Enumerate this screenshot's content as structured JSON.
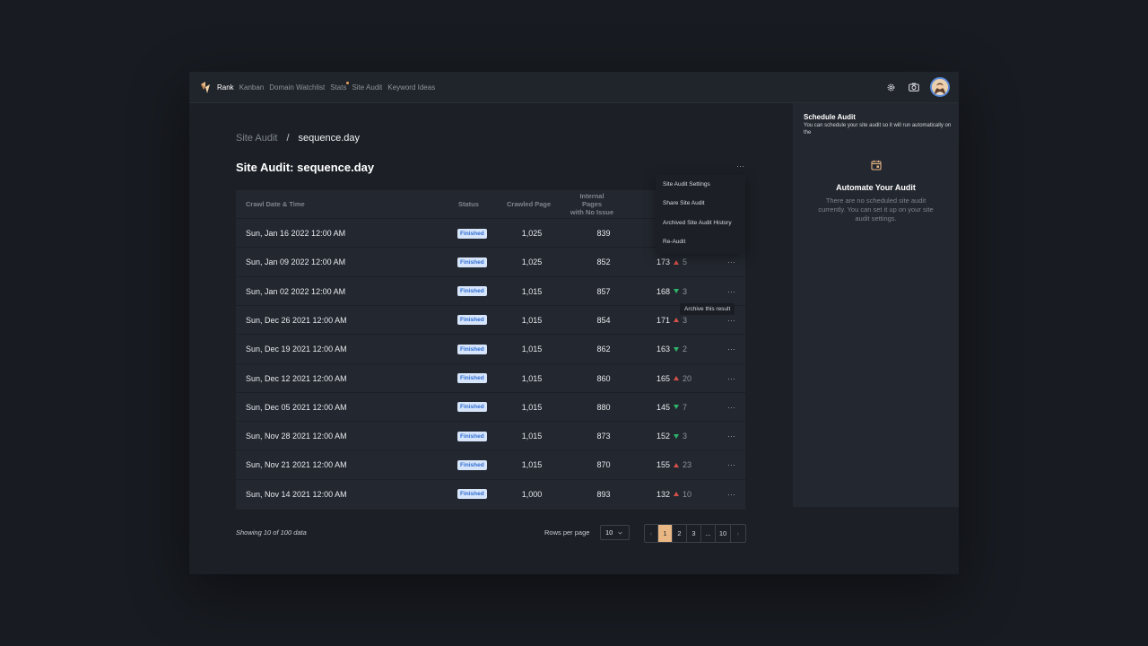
{
  "nav": {
    "items": [
      "Rank",
      "Kanban",
      "Domain Watchlist",
      "Stats",
      "Site Audit",
      "Keyword Ideas"
    ],
    "active": "Rank"
  },
  "breadcrumb": {
    "parent": "Site Audit",
    "separator": "/",
    "current": "sequence.day"
  },
  "page": {
    "title": "Site Audit: sequence.day",
    "more": "···"
  },
  "table": {
    "headers": {
      "date": "Crawl Date & Time",
      "status": "Status",
      "crawled": "Crawled Page",
      "no_issue_1": "Internal Pages",
      "no_issue_2": "with No Issue"
    },
    "rows": [
      {
        "date": "Sun, Jan 16 2022 12:00 AM",
        "status": "Finished",
        "crawled": "1,025",
        "no_issue": "839",
        "issues": "",
        "delta": "",
        "dir": ""
      },
      {
        "date": "Sun, Jan 09 2022 12:00 AM",
        "status": "Finished",
        "crawled": "1,025",
        "no_issue": "852",
        "issues": "173",
        "delta": "5",
        "dir": "up"
      },
      {
        "date": "Sun, Jan 02 2022 12:00 AM",
        "status": "Finished",
        "crawled": "1,015",
        "no_issue": "857",
        "issues": "168",
        "delta": "3",
        "dir": "down"
      },
      {
        "date": "Sun, Dec 26 2021 12:00 AM",
        "status": "Finished",
        "crawled": "1,015",
        "no_issue": "854",
        "issues": "171",
        "delta": "3",
        "dir": "up"
      },
      {
        "date": "Sun, Dec 19 2021 12:00 AM",
        "status": "Finished",
        "crawled": "1,015",
        "no_issue": "862",
        "issues": "163",
        "delta": "2",
        "dir": "down"
      },
      {
        "date": "Sun, Dec 12 2021 12:00 AM",
        "status": "Finished",
        "crawled": "1,015",
        "no_issue": "860",
        "issues": "165",
        "delta": "20",
        "dir": "up"
      },
      {
        "date": "Sun, Dec 05 2021 12:00 AM",
        "status": "Finished",
        "crawled": "1,015",
        "no_issue": "880",
        "issues": "145",
        "delta": "7",
        "dir": "down"
      },
      {
        "date": "Sun, Nov 28 2021 12:00 AM",
        "status": "Finished",
        "crawled": "1,015",
        "no_issue": "873",
        "issues": "152",
        "delta": "3",
        "dir": "down"
      },
      {
        "date": "Sun, Nov 21 2021 12:00 AM",
        "status": "Finished",
        "crawled": "1,015",
        "no_issue": "870",
        "issues": "155",
        "delta": "23",
        "dir": "up"
      },
      {
        "date": "Sun, Nov 14 2021 12:00 AM",
        "status": "Finished",
        "crawled": "1,000",
        "no_issue": "893",
        "issues": "132",
        "delta": "10",
        "dir": "up"
      }
    ],
    "row_more": "···"
  },
  "dropdown_menu": {
    "items": [
      "Site Audit Settings",
      "Share Site Audit",
      "Archived Site Audit History",
      "Re-Audit"
    ]
  },
  "tooltip": {
    "text": "Archive this result"
  },
  "footer": {
    "showing": "Showing 10 of 100 data",
    "rows_label": "Rows per page",
    "rows_value": "10",
    "pages": [
      "1",
      "2",
      "3",
      "...",
      "10"
    ],
    "current_page": "1",
    "prev": "‹",
    "next": "›"
  },
  "sidebar": {
    "title": "Schedule Audit",
    "subtitle": "You can schedule your site audit so it will run automatically on the",
    "heading": "Automate Your Audit",
    "body": "There are no scheduled site audit currently. You can set it up on your site audit settings."
  },
  "colors": {
    "accent": "#e8b784",
    "badge_bg": "#d7e5fb",
    "badge_text": "#2f6fd1",
    "up": "#d4504a",
    "down": "#2fb56a"
  },
  "icons": {
    "settings": "gear-icon",
    "camera": "camera-icon",
    "calendar": "calendar-icon",
    "logo": "rank-logo"
  }
}
